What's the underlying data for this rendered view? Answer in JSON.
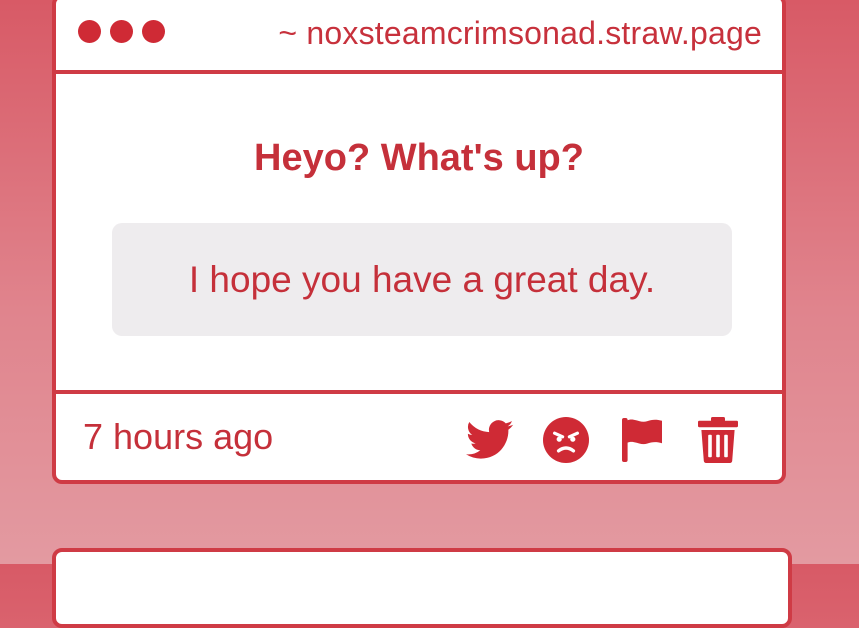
{
  "header": {
    "url": "~ noxsteamcrimsonad.straw.page",
    "dots": [
      "dot-1",
      "dot-2",
      "dot-3"
    ]
  },
  "post": {
    "question": "Heyo? What's up?",
    "answer": "I hope you have a great day.",
    "timestamp": "7 hours ago"
  },
  "actions": [
    {
      "name": "twitter-share-button",
      "icon": "twitter-bird-icon"
    },
    {
      "name": "angry-reaction-button",
      "icon": "angry-face-icon"
    },
    {
      "name": "report-button",
      "icon": "flag-icon"
    },
    {
      "name": "delete-button",
      "icon": "trash-icon"
    }
  ],
  "colors": {
    "accent": "#cf2a35",
    "border": "#cf3b45",
    "answer_background": "#eeecee",
    "page_gradient_top": "#d85a66",
    "page_gradient_bottom": "#e39aa1"
  }
}
